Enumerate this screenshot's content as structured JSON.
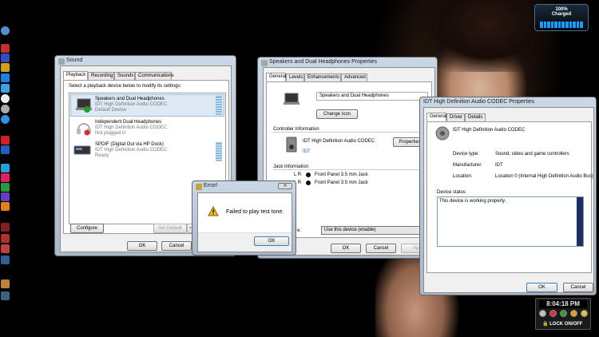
{
  "battery": {
    "percent": "100%",
    "status": "Charged"
  },
  "clock": {
    "time": "8:04:18 PM",
    "lock_label": "LOCK ON/OFF"
  },
  "sound_dialog": {
    "title": "Sound",
    "tabs": [
      "Playback",
      "Recording",
      "Sounds",
      "Communications"
    ],
    "instruction": "Select a playback device below to modify its settings:",
    "devices": [
      {
        "name": "Speakers and Dual Headphones",
        "driver": "IDT High Definition Audio CODEC",
        "status": "Default Device"
      },
      {
        "name": "Independent Dual Headphones",
        "driver": "IDT High Definition Audio CODEC",
        "status": "Not plugged in"
      },
      {
        "name": "SPDIF (Digital Out via HP Dock)",
        "driver": "IDT High Definition Audio CODEC",
        "status": "Ready"
      }
    ],
    "configure": "Configure",
    "set_default": "Set Default",
    "ok": "OK",
    "cancel": "Cancel"
  },
  "props_dialog": {
    "title": "Speakers and Dual Headphones Properties",
    "tabs": [
      "General",
      "Levels",
      "Enhancements",
      "Advanced"
    ],
    "name_value": "Speakers and Dual Headphones",
    "change_icon": "Change Icon",
    "controller_label": "Controller Information",
    "controller_name": "IDT High Definition Audio CODEC",
    "controller_vendor": "IDT",
    "properties_btn": "Properties",
    "jack_label": "Jack Information",
    "jack_lr": "L R",
    "jacks": [
      "Front Panel 3.5 mm Jack",
      "Front Panel 3.5 mm Jack"
    ],
    "usage_label": "e:",
    "usage_value": "Use this device (enable)",
    "ok": "OK",
    "cancel": "Cancel",
    "apply": "Ap"
  },
  "error_dialog": {
    "title": "Error!",
    "message": "Failed to play test tone.",
    "ok": "OK"
  },
  "codec_dialog": {
    "title": "IDT High Definition Audio CODEC Properties",
    "tabs": [
      "General",
      "Driver",
      "Details"
    ],
    "device_name": "IDT High Definition Audio CODEC",
    "rows": [
      {
        "label": "Device type:",
        "value": "Sound, video and game controllers"
      },
      {
        "label": "Manufacturer:",
        "value": "IDT"
      },
      {
        "label": "Location:",
        "value": "Location 0 (Internal High Definition Audio Bus)"
      }
    ],
    "status_label": "Device status",
    "status_text": "This device is working properly.",
    "ok": "OK",
    "cancel": "Cancel"
  }
}
